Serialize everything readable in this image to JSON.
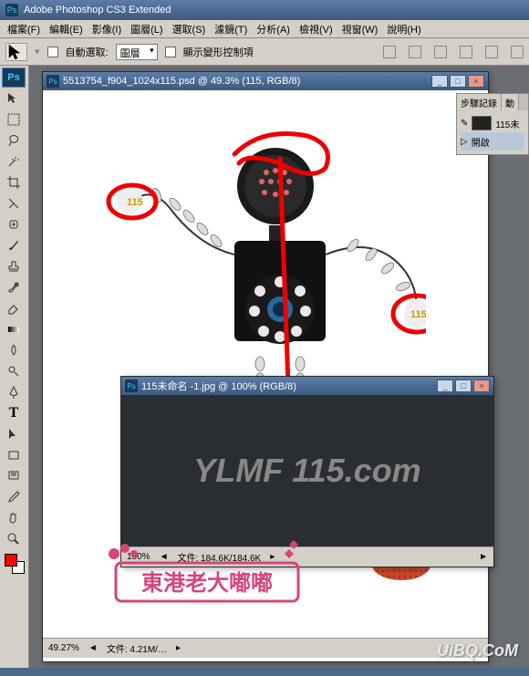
{
  "app": {
    "title": "Adobe Photoshop CS3 Extended",
    "icon": "Ps"
  },
  "menu": [
    "檔案(F)",
    "編輯(E)",
    "影像(I)",
    "圖層(L)",
    "選取(S)",
    "濾鏡(T)",
    "分析(A)",
    "檢視(V)",
    "視窗(W)",
    "說明(H)"
  ],
  "options": {
    "auto_select_label": "自動選取:",
    "layer_select": "圖層",
    "show_transform": "顯示變形控制項"
  },
  "main_doc": {
    "title": "5513754_f904_1024x115.psd @ 49.3% (115, RGB/8)",
    "zoom": "49.27%",
    "file_info": "文件: 4.21M/…"
  },
  "sub_doc": {
    "title": "115未命名 -1.jpg @ 100% (RGB/8)",
    "logo_text": "YLMF 115.com",
    "zoom": "100%",
    "file_info": "文件: 184.6K/184.6K"
  },
  "panel": {
    "tab1": "步驟記錄",
    "tab2": "動",
    "item": "115未",
    "open_label": "開啟"
  },
  "watermark": "UiBQ.CoM",
  "stamp_text": "東港老大嘟嘟",
  "tools": [
    "move",
    "marquee",
    "lasso",
    "wand",
    "crop",
    "slice",
    "healing",
    "brush",
    "stamp",
    "history-brush",
    "eraser",
    "gradient",
    "blur",
    "dodge",
    "pen",
    "type",
    "path-select",
    "rectangle",
    "notes",
    "eyedropper",
    "hand",
    "zoom"
  ]
}
